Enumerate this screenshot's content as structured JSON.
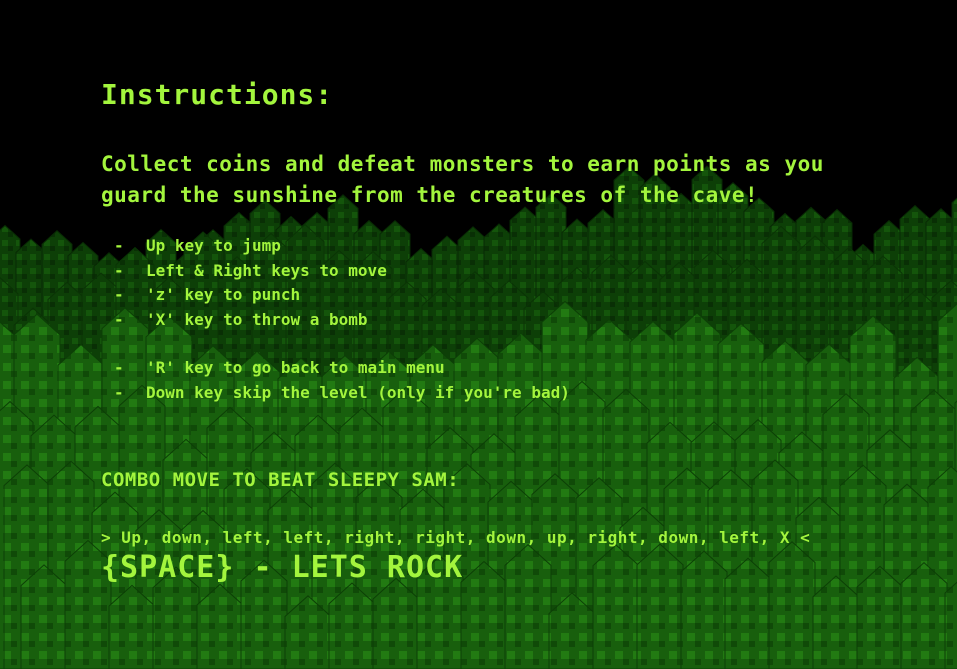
{
  "colors": {
    "text": "#a3f53d",
    "background": "#000000",
    "cave_dark": "#0c3a06",
    "cave_mid": "#165a0c",
    "cave_light": "#237a12"
  },
  "instructions": {
    "title": "Instructions:",
    "intro_line_1": "Collect coins and defeat monsters to earn points as you",
    "intro_line_2": "guard the sunshine from the creatures of the cave!",
    "controls": [
      {
        "bullet": "-",
        "text": "Up key to jump"
      },
      {
        "bullet": "-",
        "text": "Left & Right keys to move"
      },
      {
        "bullet": "-",
        "text": "'z' key to punch"
      },
      {
        "bullet": "-",
        "text": "'X' key to throw a bomb"
      }
    ],
    "extra_controls": [
      {
        "bullet": "-",
        "text": "'R' key to go back to main menu"
      },
      {
        "bullet": "-",
        "text": "Down key skip the level (only if you're bad)"
      }
    ]
  },
  "combo": {
    "heading": "COMBO MOVE TO BEAT SLEEPY SAM:",
    "sequence": ">  Up, down, left, left, right, right, down, up, right, down, left, X  <"
  },
  "start_prompt": "{SPACE} - LETS ROCK",
  "background_scene": "cave-crystals"
}
